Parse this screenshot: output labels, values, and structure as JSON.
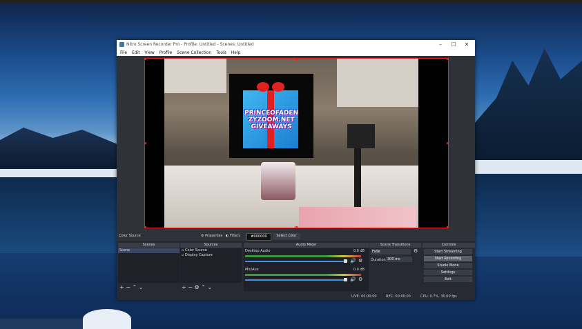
{
  "window": {
    "title": "Nitro Screen Recorder Pro - Profile: Untitled - Scenes: Untitled",
    "controls": [
      "–",
      "☐",
      "✕"
    ]
  },
  "menu": [
    "File",
    "Edit",
    "View",
    "Profile",
    "Scene Collection",
    "Tools",
    "Help"
  ],
  "preview": {
    "watermark_lines": [
      "PRINCEOFADEN",
      "ZYZOOM.NET",
      "GIVEAWAYS"
    ]
  },
  "source_toolbar": {
    "source_name": "Color Source",
    "properties_label": "Properties",
    "filters_label": "Filters",
    "color_value": "#000000",
    "select_color_label": "Select color"
  },
  "docks": {
    "scenes": {
      "title": "Scenes",
      "items": [
        "Scene"
      ]
    },
    "sources": {
      "title": "Sources",
      "items": [
        "Color Source",
        "Display Capture"
      ]
    },
    "audio_mixer": {
      "title": "Audio Mixer",
      "channels": [
        {
          "name": "Desktop Audio",
          "level": "0.0 dB"
        },
        {
          "name": "Mic/Aux",
          "level": "0.0 dB"
        }
      ]
    },
    "transitions": {
      "title": "Scene Transitions",
      "type": "Fade",
      "duration_label": "Duration",
      "duration_value": "300 ms"
    },
    "controls": {
      "title": "Controls",
      "buttons": [
        "Start Streaming",
        "Start Recording",
        "Studio Mode",
        "Settings",
        "Exit"
      ]
    }
  },
  "status": {
    "live": "LIVE: 00:00:00",
    "rec": "REC: 00:00:00",
    "cpu": "CPU: 0.7%, 30.00 fps"
  },
  "colors": {
    "accent": "#e02222",
    "panel": "#272a33",
    "highlight": "#3c4660"
  }
}
